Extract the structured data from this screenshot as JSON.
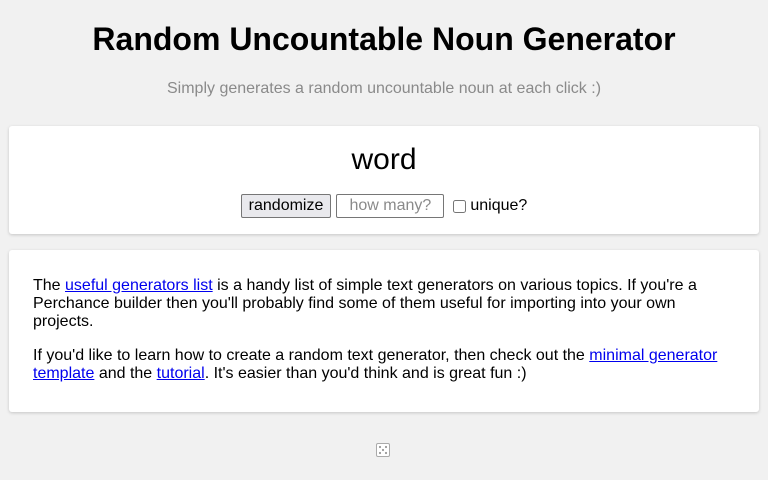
{
  "header": {
    "title": "Random Uncountable Noun Generator",
    "subtitle": "Simply generates a random uncountable noun at each click :)"
  },
  "generator": {
    "output": "word",
    "randomize_label": "randomize",
    "count_placeholder": "how many?",
    "count_value": "",
    "unique_label": "unique?",
    "unique_checked": false
  },
  "info": {
    "p1_before": "The ",
    "p1_link": "useful generators list",
    "p1_after": " is a handy list of simple text generators on various topics. If you're a Perchance builder then you'll probably find some of them useful for importing into your own projects.",
    "p2_before": "If you'd like to learn how to create a random text generator, then check out the ",
    "p2_link1": "minimal generator template",
    "p2_mid": " and the ",
    "p2_link2": "tutorial",
    "p2_after": ". It's easier than you'd think and is great fun :)"
  },
  "footer": {
    "icon": "dice-icon"
  },
  "colors": {
    "background": "#f1f1f1",
    "card": "#ffffff",
    "link": "#0000ee",
    "muted": "#8a8a8a"
  }
}
